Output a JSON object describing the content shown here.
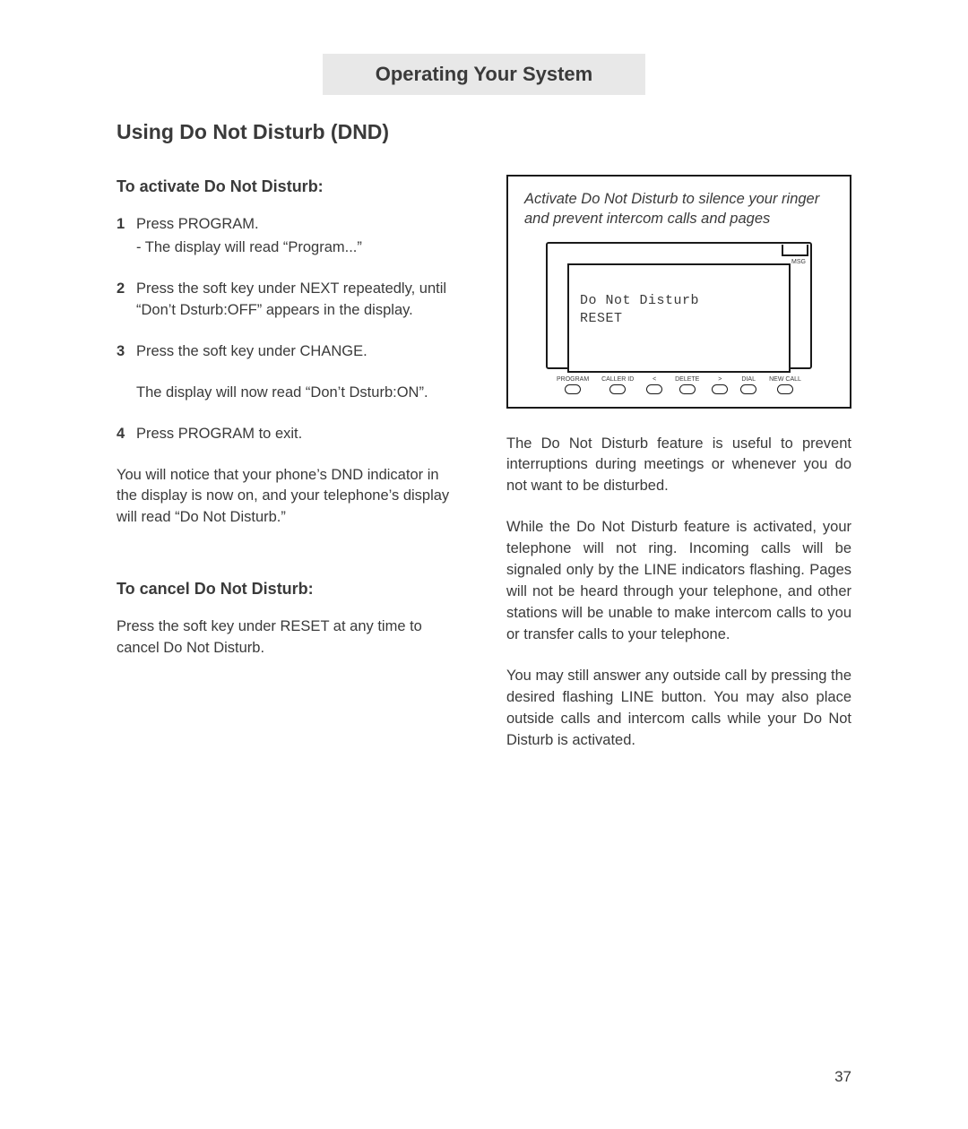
{
  "header": "Operating Your System",
  "title": "Using Do Not Disturb (DND)",
  "left": {
    "activate_title": "To activate Do Not Disturb:",
    "steps": [
      {
        "n": "1",
        "text": "Press PROGRAM.",
        "sub": "- The display will read “Program...”"
      },
      {
        "n": "2",
        "text": "Press the soft key under NEXT repeatedly, until “Don’t Dsturb:OFF” appears in the display.",
        "sub": ""
      },
      {
        "n": "3",
        "text": "Press the soft key under CHANGE.",
        "sub": "The display will now read “Don’t Dsturb:ON”."
      },
      {
        "n": "4",
        "text": "Press PROGRAM to exit.",
        "sub": ""
      }
    ],
    "after_steps": "You will notice that your phone’s DND indicator in the display is now on, and your telephone’s display will read “Do Not Disturb.”",
    "cancel_title": "To cancel Do Not Disturb:",
    "cancel_text": "Press the soft key under RESET at any time to cancel Do Not Disturb."
  },
  "right": {
    "callout": "Activate Do Not Disturb to silence your ringer and prevent intercom calls and pages",
    "screen_line1": "Do Not Disturb",
    "screen_line2": "RESET",
    "msg_label": "MSG",
    "buttons": [
      "PROGRAM",
      "CALLER ID",
      "<",
      "DELETE",
      ">",
      "DIAL",
      "NEW CALL"
    ],
    "p1": "The Do Not Disturb feature is useful to prevent interruptions during meetings or whenever you do not want to be disturbed.",
    "p2": "While the Do Not Disturb feature is activated, your telephone will not ring. Incoming calls will be signaled only by the LINE indicators flashing. Pages will not be heard through your telephone, and other stations will be unable to make intercom calls to you or transfer calls to your telephone.",
    "p3": "You may still answer any outside call by pressing the desired flashing LINE button. You may also place outside calls and intercom calls while your Do Not Disturb is activated."
  },
  "page_number": "37"
}
